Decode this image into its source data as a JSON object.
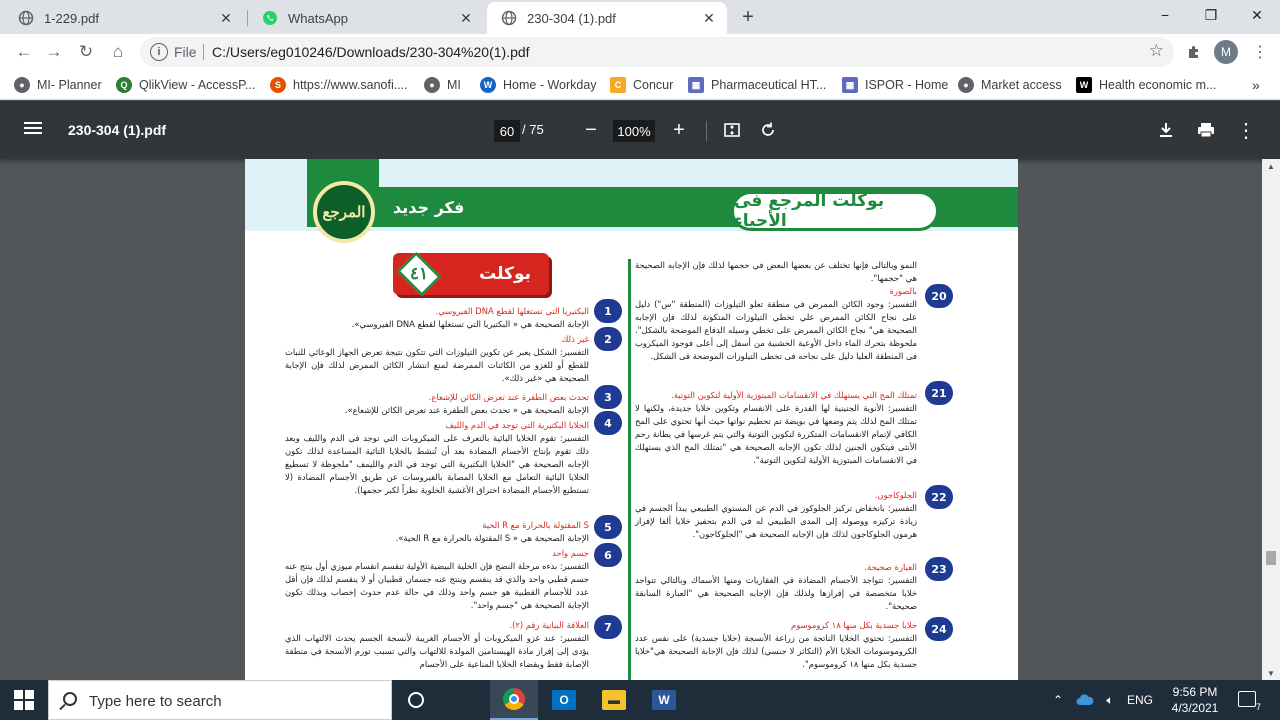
{
  "browser": {
    "tabs": [
      {
        "title": "1-229.pdf",
        "icon": "globe-icon"
      },
      {
        "title": "WhatsApp",
        "icon": "whatsapp-icon"
      },
      {
        "title": "230-304 (1).pdf",
        "icon": "globe-icon",
        "active": true
      }
    ],
    "new_tab": "+",
    "window_controls": {
      "minimize": "−",
      "restore": "❐",
      "close": "✕"
    },
    "nav": {
      "back": "←",
      "forward": "→",
      "reload": "↻",
      "home": "⌂"
    },
    "omnibox": {
      "label": "File",
      "url": "C:/Users/eg010246/Downloads/230-304%20(1).pdf"
    },
    "profile_initial": "M",
    "bookmarks": [
      {
        "label": "MI- Planner",
        "color": "#5f6368"
      },
      {
        "label": "QlikView - AccessP...",
        "color": "#2e7d32"
      },
      {
        "label": "https://www.sanofi....",
        "color": "#e65100"
      },
      {
        "label": "MI",
        "color": "#5f6368"
      },
      {
        "label": "Home - Workday",
        "color": "#1565c0"
      },
      {
        "label": "Concur",
        "color": "#f9a825"
      },
      {
        "label": "Pharmaceutical HT...",
        "color": "#5c6bc0"
      },
      {
        "label": "ISPOR - Home",
        "color": "#5c6bc0"
      },
      {
        "label": "Market access",
        "color": "#5f6368"
      },
      {
        "label": "Health economic m...",
        "color": "#000000"
      }
    ],
    "bookmarks_more": "»"
  },
  "pdf_viewer": {
    "file_name": "230-304 (1).pdf",
    "current_page": "60",
    "total_pages": "/ 75",
    "zoom": "100%",
    "zoom_out": "−",
    "zoom_in": "+"
  },
  "document": {
    "header_left": "فكر جديد",
    "seal_text": "المرجع",
    "header_right": "بوكلت المرجع فى الأحياء",
    "booklet_label": "بوكلت",
    "booklet_number": "٤١",
    "right_column": [
      {
        "num": "20",
        "lines": [
          "النمو وبالتالى فإنها تختلف عن بعضها البعض في حجمها لذلك فإن الإجابه الصحيحة هي \"حجمها\".",
          "بالصورة",
          "التفسير: وجود الكائن الممرض في منطقة تعلو التيلوزات (المنطقة \"س\") دليل على نجاح الكائن الممرض علي تخطي التيلوزات المتكونة لذلك فإن الإجابه الصحيحة هي\" نجاح الكائن الممرض على تخطي وسيله الدفاع الموضحة بالشكل\". ملحوظة بتحرك الماء داخل الأوعية الخشبية من أسفل إلى أعلى فوجود الميكروب فى المنطقة العليا دليل على نجاحه فى تخطى التيلوزات الموضحة فى الشكل."
        ]
      },
      {
        "num": "21",
        "lines": [
          "تمتلك المح التي يستهلك في الانقسامات الميتوزية الأولية لتكوين التوتية.",
          "التفسير: الأنوية الجنينية لها القدرة على الانقسام وتكوين خلايا جديدة، ولكنها لا تمتلك المح لذلك يتم وضعها في بويضة تم تحطيم نواتها حيث أنها تحتوي على المح الكافي لإتمام الانقسامات المتكررة لتكوين التوتية والتي يتم غرسها في بطانة رحم الأنثى فيتكون الجنين لذلك تكون الإجابه الصحيحة هي \"تمتلك المح الذي يستهلك في الانقسامات الميتوزية الأولية لتكوين التوتية\"."
        ]
      },
      {
        "num": "22",
        "lines": [
          "الجلوكاجون.",
          "التفسير: بانخفاض تركيز الجلوكوز في الدم عن المستوي الطبيعي يبدأ الجسم في زيادة تركيزه ووصوله إلى المدى الطبيعي له في الدم بتحفيز خلايا ألفا لإفراز هرمون الجلوكاجون لذلك فإن الإجابه الصحيحة هي \"الجلوكاجون\"."
        ]
      },
      {
        "num": "23",
        "lines": [
          "العبارة صحيحة.",
          "التفسير: تتواجد الأجسام المضادة في الفقاريات ومنها الأسماك وبالتالي تتواجد خلايا متخصصة في إفرازها ولذلك فإن الإجابه الصحيحة هي \"العبارة السابقة صحيحة\"."
        ]
      },
      {
        "num": "24",
        "lines": [
          "خلايا جسدية بكل منها ١٨ كروموسوم",
          "التفسير: تحتوي الخلايا الناتجة من زراعة الأنسجة (خلايا جسدية) على نفس عدد الكروموسومات الخلايا الأم (التكاثر لا جنسي) لذلك فإن الإجابة الصحيحة هي\"خلايا جسدية بكل منها ١٨ كروموسوم\"."
        ]
      }
    ],
    "left_column": [
      {
        "num": "1",
        "lines": [
          "البكتيريا التي تستغلها لقطع DNA الفيروسي.",
          "الإجابة الصحيحة هي « البكتيريا التي تستغلها لقطع DNA الفيروسي»."
        ]
      },
      {
        "num": "2",
        "lines": [
          "غير ذلك",
          "التفسير: الشكل يعبر عن تكوين التيلوزات التي تتكون نتيجة تعرض الجهاز الوعائي للنبات للقطع أو للغزو من الكائنات الممرضة لمنع انتشار الكائن الممرض لذلك فإن الإجابة الصحيحة هي «غير ذلك»."
        ]
      },
      {
        "num": "3",
        "lines": [
          "تحدث بعض الطفرة عند تعرض الكائن للإشعاع.",
          "الإجابة الصحيحة هي « تحدث بعض الطفرة عند تعرض الكائن للإشعاع»."
        ]
      },
      {
        "num": "4",
        "lines": [
          "الخلايا البكتيرية التي توجد في الدم والليف",
          "التفسير: تقوم الخلايا البائية بالتعرف على الميكروبات التي توجد في الدم والليف وبعد ذلك تقوم بإنتاج الأجسام المضادة بعد أن تُنشط بالخلايا التائية المساعدة لذلك تكون الإجابه الصحيحة هي \"الخلايا البكتيرية التي توجد في الدم والليمف \"ملحوظة لا تسطيع الخلايا البائية التعامل مع الخلايا المصابة بالفيروسات عن طريق الأجسام المضادة (لا تستطيع الأجسام المضادة اختراق الأغشية الخلوية نظراً لكبر حجمها)."
        ]
      },
      {
        "num": "5",
        "lines": [
          "S المقتولة بالحرارة مع R الحية",
          "الإجابة الصحيحة هي « S المقتولة بالحرارة مع R الحية»."
        ]
      },
      {
        "num": "6",
        "lines": [
          "جسم واحد",
          "التفسير: بدءه مرحلة النضج فإن الخلية البيضية الأولية تنقسم انقسام ميوزي أول ينتج عنه جسم قطبي واحد والذي قد ينقسم وينتج عنه جسمان قطبيان أو لا ينقسم لذلك فإن أقل عدد للأجسام القطبية هو جسم واحد وذلك في حالة عدم حدوث إخصاب وبذلك تكون الإجابة الصحيحة هي \"جسم واحد\"."
        ]
      },
      {
        "num": "7",
        "lines": [
          "العلاقة البيانية رقم (٢).",
          "التفسير: عند غزو الميكروبات أو الأجسام الغريبة لأنسجة الجسم يحدث الالتهاب الذي يؤدى إلى إفراز مادة الهيستامين المولدة للالتهاب والتي تسبب تورم الأنسجة في منطقة الإصابة فقط وبقضاء الخلايا المناعية على الأجسام"
        ]
      }
    ]
  },
  "taskbar": {
    "search_placeholder": "Type here to search",
    "apps": [
      "task-view",
      "chrome",
      "outlook",
      "file-explorer",
      "word"
    ],
    "language": "ENG",
    "time": "9:56 PM",
    "date": "4/3/2021",
    "notifications": "7"
  }
}
